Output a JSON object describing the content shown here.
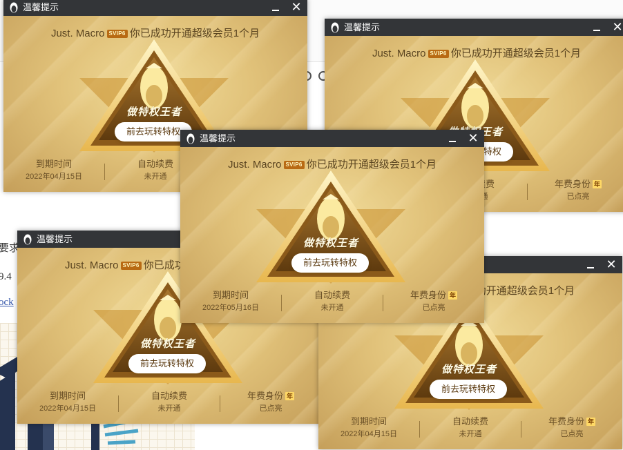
{
  "background": {
    "text_fragment_1": "要求",
    "text_fragment_2": "9.4",
    "text_fragment_3": "ock"
  },
  "popup": {
    "title": "温馨提示",
    "icon": "qq-penguin-icon",
    "nickname": "Just. Macro",
    "svip_badge": "SVIP6",
    "message": "你已成功开通超级会员1个月",
    "slogan": "做特权王者",
    "cta_label": "前去玩转特权",
    "stats": [
      {
        "label": "到期时间",
        "value": "2022年04月15日"
      },
      {
        "label": "自动续费",
        "value": "未开通"
      },
      {
        "label": "年费身份",
        "badge": "年",
        "value": "已点亮"
      }
    ]
  },
  "popups": [
    {
      "id": "popup-1",
      "expiry": "2022年04月15日"
    },
    {
      "id": "popup-2",
      "expiry": "2022年04月15日"
    },
    {
      "id": "popup-3",
      "expiry": "2022年04月15日"
    },
    {
      "id": "popup-4",
      "expiry": "2022年04月15日"
    },
    {
      "id": "popup-5",
      "expiry": "2022年05月16日"
    }
  ],
  "colors": {
    "titlebar": "#333538",
    "gold_light": "#f1dc9a",
    "gold_dark": "#c59f5a",
    "emblem_brown": "#6b4312",
    "svip_badge": "#b86a13"
  }
}
